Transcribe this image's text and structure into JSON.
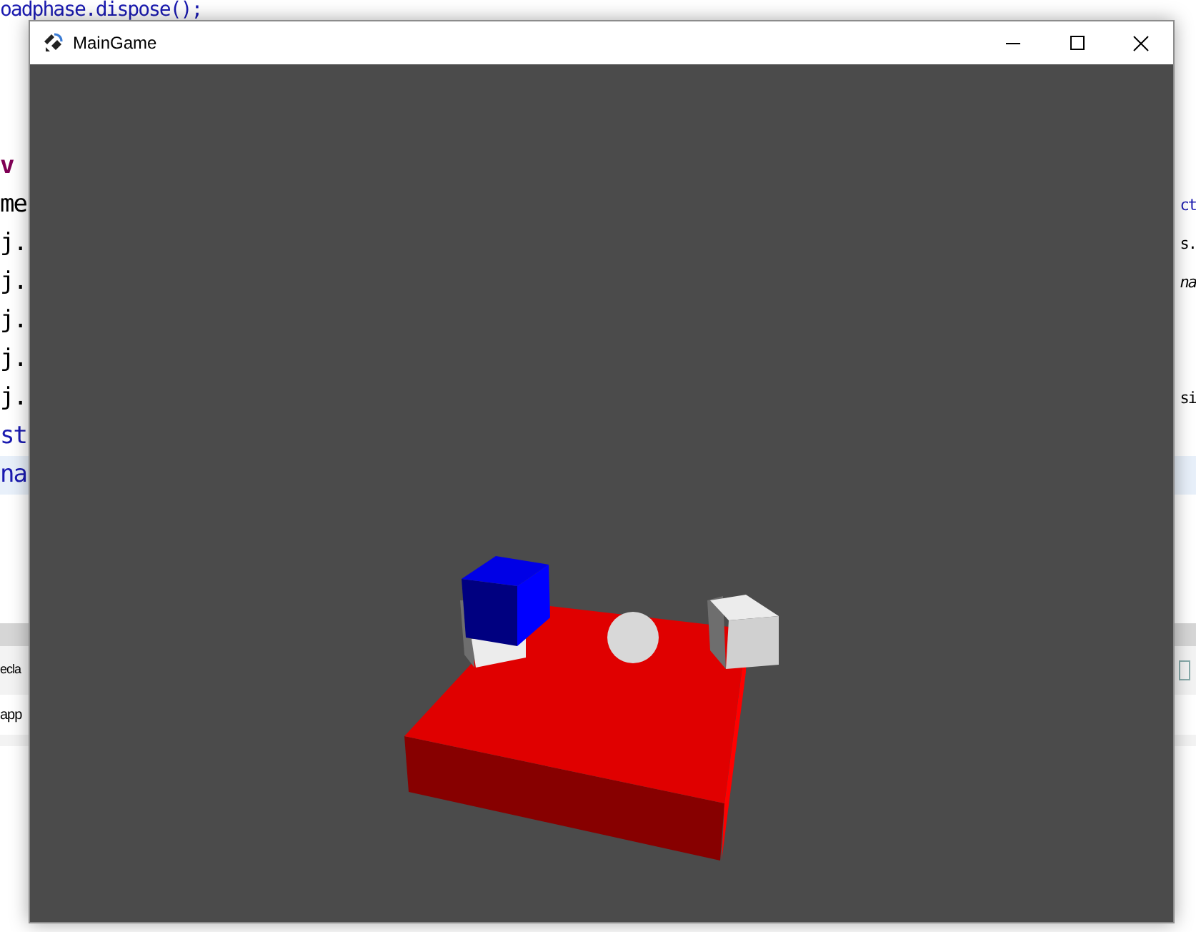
{
  "editor": {
    "lines": [
      {
        "left": {
          "text": "oadphase.dispose();",
          "kind": "type"
        },
        "highlighted": false
      },
      {
        "left": {
          "text": "v",
          "kind": "keyword"
        },
        "highlighted": false
      },
      {
        "left": {
          "text": "me",
          "kind": "plain"
        },
        "right": {
          "text": "ct",
          "kind": "type"
        },
        "highlighted": false
      },
      {
        "left": {
          "text": "j.",
          "kind": "plain"
        },
        "right": {
          "text": "s.",
          "kind": "plain"
        },
        "highlighted": false
      },
      {
        "left": {
          "text": "j.",
          "kind": "plain"
        },
        "right": {
          "text": "na",
          "kind": "italic"
        },
        "highlighted": false
      },
      {
        "left": {
          "text": "j.",
          "kind": "plain"
        },
        "highlighted": false
      },
      {
        "left": {
          "text": "j.",
          "kind": "plain"
        },
        "highlighted": false
      },
      {
        "left": {
          "text": "j.",
          "kind": "plain"
        },
        "right": {
          "text": "si",
          "kind": "plain"
        },
        "highlighted": false
      },
      {
        "left": {
          "text": "st",
          "kind": "type"
        },
        "highlighted": false
      },
      {
        "left": {
          "text": "na",
          "kind": "type"
        },
        "highlighted": true
      }
    ]
  },
  "bottom_panel": {
    "tab": "ecla",
    "console": "app"
  },
  "window": {
    "title": "MainGame"
  }
}
